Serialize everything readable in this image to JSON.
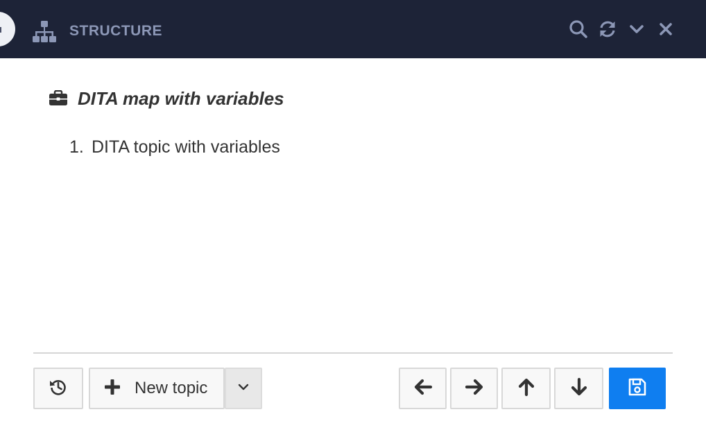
{
  "header": {
    "title": "STRUCTURE",
    "bg_color": "#1d2337",
    "title_color": "#8c97b6",
    "icons": [
      "sitemap-icon",
      "search-icon",
      "refresh-icon",
      "chevron-down-icon",
      "close-icon"
    ]
  },
  "map": {
    "icon": "briefcase-icon",
    "title": "DITA map with variables"
  },
  "topics": [
    {
      "number": "1.",
      "title": "DITA topic with variables"
    }
  ],
  "toolbar": {
    "history_icon": "history-icon",
    "new_topic_label": "New topic",
    "new_topic_icon": "plus-icon",
    "dropdown_icon": "chevron-down-icon",
    "move_icons": [
      "arrow-left-icon",
      "arrow-right-icon",
      "arrow-up-icon",
      "arrow-down-icon"
    ],
    "save_icon": "save-icon",
    "save_color": "#0f7ef0"
  }
}
